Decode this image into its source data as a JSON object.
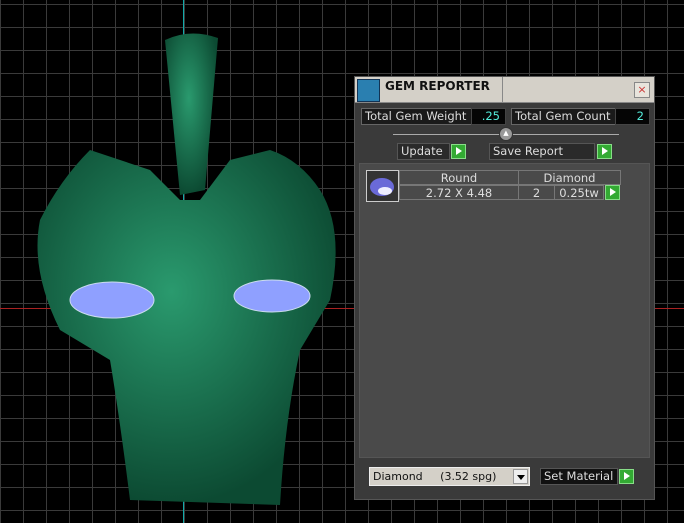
{
  "window": {
    "title": "GEM REPORTER",
    "close_label": "×"
  },
  "totals": {
    "weight_label": "Total Gem Weight",
    "weight_value": ".25",
    "count_label": "Total Gem Count",
    "count_value": "2"
  },
  "buttons": {
    "update": "Update",
    "save_report": "Save Report",
    "set_material": "Set Material"
  },
  "gems": [
    {
      "shape": "Round",
      "material": "Diamond",
      "size": "2.72 X 4.48",
      "count": "2",
      "weight": "0.25tw"
    }
  ],
  "material_select": {
    "selected": "Diamond     (3.52 spg)"
  },
  "colors": {
    "model": "#1e7a55",
    "gem": "#8fa0ff",
    "accent_cyan": "#55ddcc",
    "go_button": "#33aa33"
  }
}
